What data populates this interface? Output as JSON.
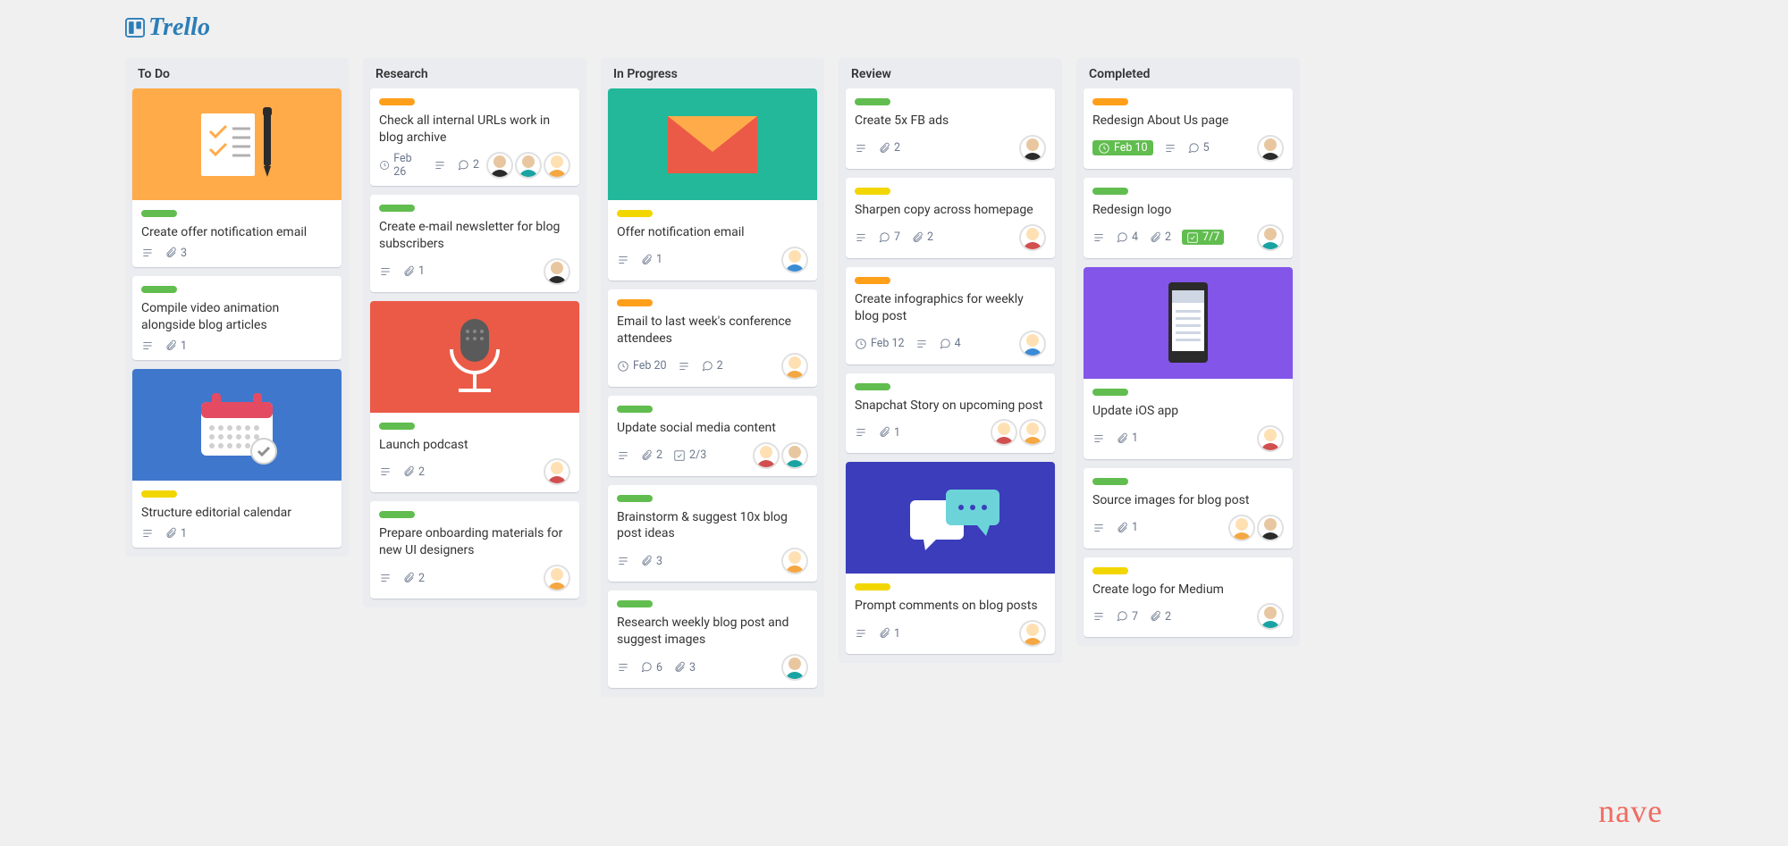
{
  "brand": {
    "logo_text": "Trello",
    "footer_brand": "nave"
  },
  "avatars": {
    "dark": {
      "body": "#2b2b2b",
      "head": "#e8c7a0"
    },
    "teal": {
      "body": "#1aa3a3",
      "head": "#e8c7a0"
    },
    "orange": {
      "body": "#f4a742",
      "head": "#ffe0b3"
    },
    "red": {
      "body": "#d14f4f",
      "head": "#ffe0b3"
    },
    "blue": {
      "body": "#3b8bd4",
      "head": "#ffe0b3"
    }
  },
  "lists": [
    {
      "title": "To Do",
      "cards": [
        {
          "cover": "orange",
          "cover_icon": "doc-pen",
          "label": "green",
          "title": "Create offer notification email",
          "badges": {
            "desc": true,
            "att": "3"
          }
        },
        {
          "label": "green",
          "title": "Compile video animation alongside blog articles",
          "badges": {
            "desc": true,
            "att": "1"
          }
        },
        {
          "cover": "blue",
          "cover_icon": "calendar",
          "label": "yellow",
          "title": "Structure editorial calendar",
          "badges": {
            "desc": true,
            "att": "1"
          }
        }
      ]
    },
    {
      "title": "Research",
      "cards": [
        {
          "label": "orange",
          "title": "Check all internal URLs work in blog archive",
          "badges": {
            "due": "Feb 26",
            "desc": true,
            "com": "2"
          },
          "members": [
            "dark",
            "teal",
            "orange"
          ]
        },
        {
          "label": "green",
          "title": "Create e-mail newsletter for blog subscribers",
          "badges": {
            "desc": true,
            "att": "1"
          },
          "members": [
            "dark"
          ]
        },
        {
          "cover": "red",
          "cover_icon": "mic",
          "label": "green",
          "title": "Launch podcast",
          "badges": {
            "desc": true,
            "att": "2"
          },
          "members": [
            "red"
          ]
        },
        {
          "label": "green",
          "title": "Prepare onboarding materials for new UI designers",
          "badges": {
            "desc": true,
            "att": "2"
          },
          "members": [
            "orange"
          ]
        }
      ]
    },
    {
      "title": "In Progress",
      "cards": [
        {
          "cover": "teal",
          "cover_icon": "envelope",
          "label": "yellow",
          "title": "Offer notification email",
          "badges": {
            "desc": true,
            "att": "1"
          },
          "members": [
            "blue"
          ]
        },
        {
          "label": "orange",
          "title": "Email to last week's conference attendees",
          "badges": {
            "due": "Feb 20",
            "desc": true,
            "com": "2"
          },
          "members": [
            "orange"
          ]
        },
        {
          "label": "green",
          "title": "Update social media content",
          "badges": {
            "desc": true,
            "att": "2",
            "check": "2/3"
          },
          "members": [
            "red",
            "teal"
          ]
        },
        {
          "label": "green",
          "title": "Brainstorm & suggest 10x blog post ideas",
          "badges": {
            "desc": true,
            "att": "3"
          },
          "members": [
            "orange"
          ]
        },
        {
          "label": "green",
          "title": "Research weekly blog post and suggest images",
          "badges": {
            "desc": true,
            "att": "3",
            "com": "6"
          },
          "members": [
            "teal"
          ]
        }
      ]
    },
    {
      "title": "Review",
      "cards": [
        {
          "label": "green",
          "title": "Create 5x FB ads",
          "badges": {
            "desc": true,
            "att": "2"
          },
          "members": [
            "dark"
          ]
        },
        {
          "label": "yellow",
          "title": "Sharpen copy across homepage",
          "badges": {
            "desc": true,
            "com": "7",
            "att": "2"
          },
          "members": [
            "red"
          ]
        },
        {
          "label": "orange",
          "title": "Create infographics for weekly blog post",
          "badges": {
            "due": "Feb 12",
            "desc": true,
            "com": "4"
          },
          "members": [
            "blue"
          ]
        },
        {
          "label": "green",
          "title": "Snapchat Story on upcoming post",
          "badges": {
            "desc": true,
            "att": "1"
          },
          "members": [
            "red",
            "orange"
          ]
        },
        {
          "cover": "indigo",
          "cover_icon": "chat",
          "label": "yellow",
          "title": "Prompt comments on blog posts",
          "badges": {
            "desc": true,
            "att": "1"
          },
          "members": [
            "orange"
          ]
        }
      ]
    },
    {
      "title": "Completed",
      "cards": [
        {
          "label": "orange",
          "title": "Redesign About Us page",
          "badges": {
            "due_complete": "Feb 10",
            "desc": true,
            "com": "5"
          },
          "members": [
            "dark"
          ]
        },
        {
          "label": "green",
          "title": "Redesign logo",
          "badges": {
            "desc": true,
            "com": "4",
            "att": "2",
            "check_complete": "7/7"
          },
          "members": [
            "teal"
          ]
        },
        {
          "cover": "purple",
          "cover_icon": "phone",
          "label": "green",
          "title": "Update iOS app",
          "badges": {
            "desc": true,
            "att": "1"
          },
          "members": [
            "red"
          ]
        },
        {
          "label": "green",
          "title": "Source images for blog post",
          "badges": {
            "desc": true,
            "att": "1"
          },
          "members": [
            "orange",
            "dark"
          ]
        },
        {
          "label": "yellow",
          "title": "Create logo for Medium",
          "badges": {
            "desc": true,
            "com": "7",
            "att": "2"
          },
          "members": [
            "teal"
          ]
        }
      ]
    }
  ]
}
